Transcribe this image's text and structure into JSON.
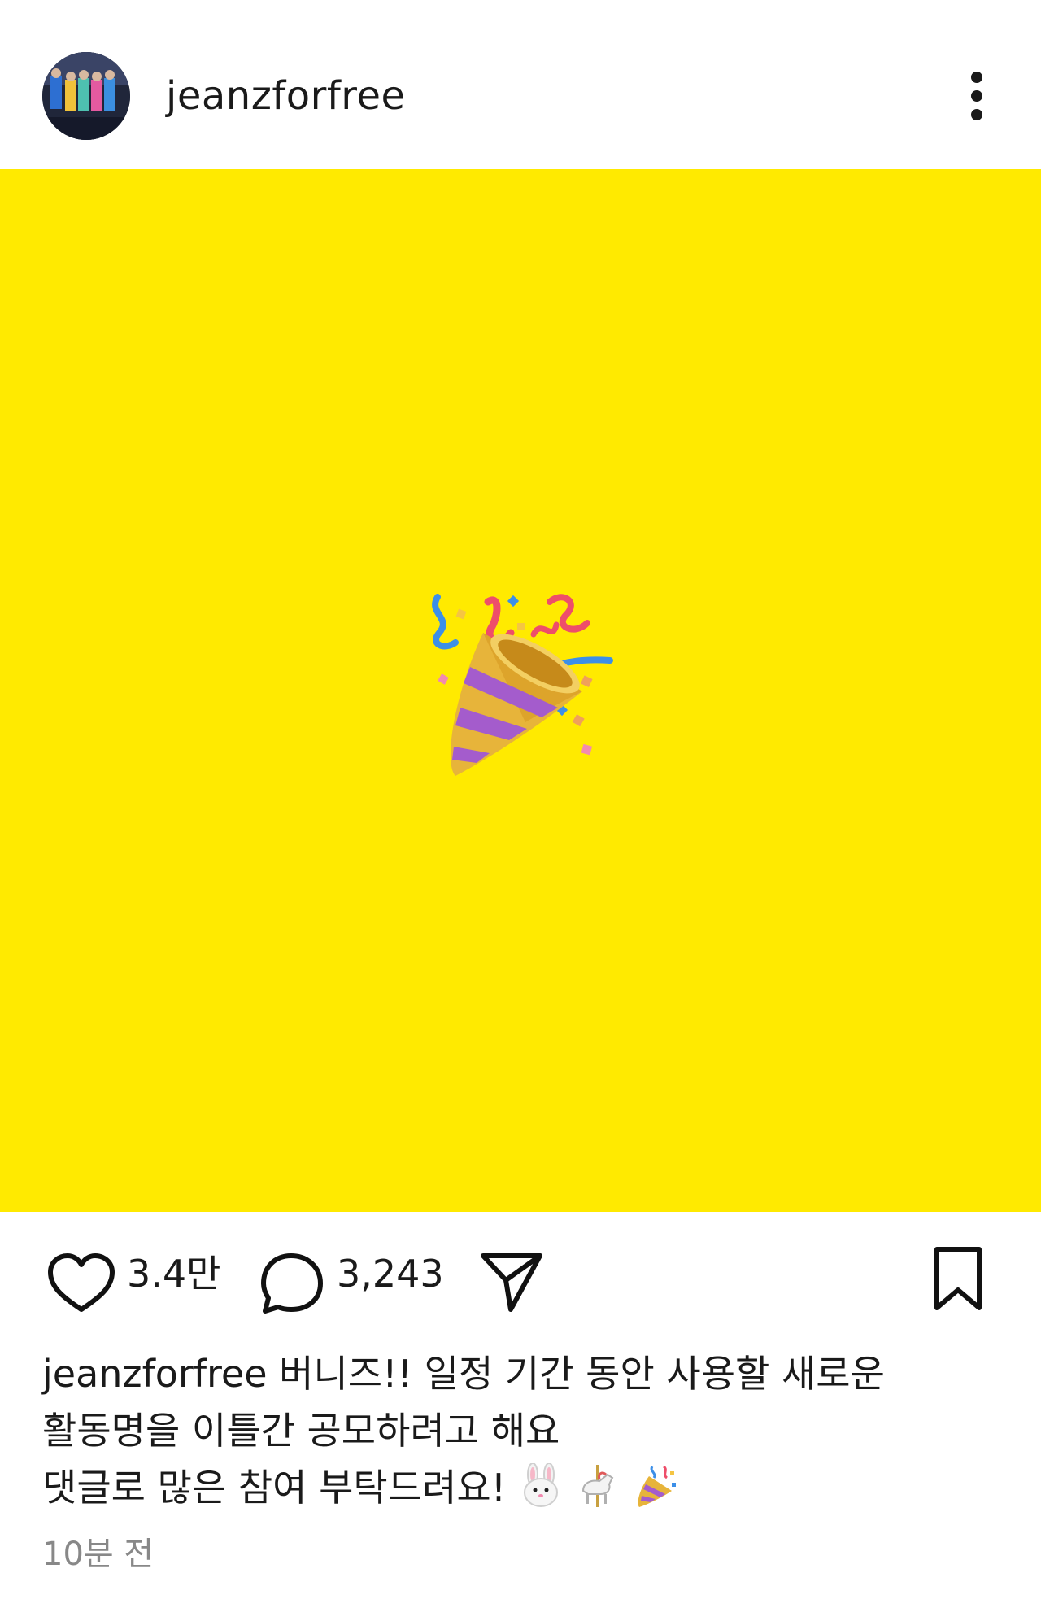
{
  "post": {
    "username": "jeanzforfree",
    "image": {
      "background": "#ffea00",
      "icon": "party-popper-icon"
    },
    "likes": "3.4만",
    "comments": "3,243",
    "caption": {
      "username": "jeanzforfree",
      "line1": "버니즈!! 일정 기간 동안 사용할 새로운",
      "line2": "활동명을 이틀간 공모하려고 해요",
      "line3": "댓글로 많은 참여 부탁드려요!",
      "emojis": [
        "rabbit-face-icon",
        "carousel-horse-icon",
        "party-popper-icon"
      ]
    },
    "timestamp": "10분 전"
  },
  "icons": {
    "more": "more-vertical-icon",
    "like": "heart-icon",
    "comment": "comment-bubble-icon",
    "share": "send-icon",
    "save": "bookmark-icon"
  },
  "colors": {
    "text": "#1a1a1a",
    "muted": "#888888",
    "accent": "#ffea00"
  }
}
